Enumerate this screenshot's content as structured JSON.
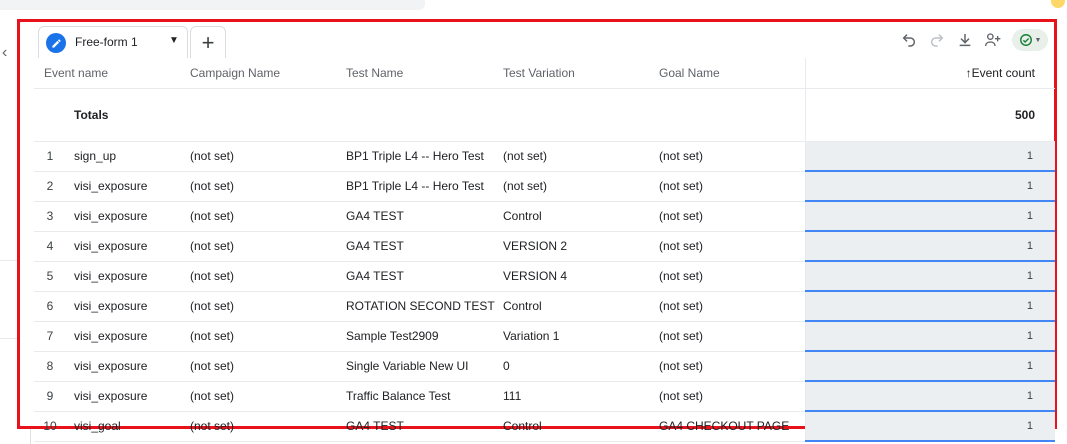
{
  "tab": {
    "label": "Free-form 1"
  },
  "columns": {
    "event_name": "Event name",
    "campaign_name": "Campaign Name",
    "test_name": "Test Name",
    "test_variation": "Test Variation",
    "goal_name": "Goal Name",
    "event_count": "↑Event count"
  },
  "totals": {
    "label": "Totals",
    "event_count": "500"
  },
  "rows": [
    {
      "index": "1",
      "event_name": "sign_up",
      "campaign": "(not set)",
      "test_name": "BP1 Triple L4 -- Hero Test",
      "variation": "(not set)",
      "goal": "(not set)",
      "count": "1"
    },
    {
      "index": "2",
      "event_name": "visi_exposure",
      "campaign": "(not set)",
      "test_name": "BP1 Triple L4 -- Hero Test",
      "variation": "(not set)",
      "goal": "(not set)",
      "count": "1"
    },
    {
      "index": "3",
      "event_name": "visi_exposure",
      "campaign": "(not set)",
      "test_name": "GA4 TEST",
      "variation": "Control",
      "goal": "(not set)",
      "count": "1"
    },
    {
      "index": "4",
      "event_name": "visi_exposure",
      "campaign": "(not set)",
      "test_name": "GA4 TEST",
      "variation": "VERSION 2",
      "goal": "(not set)",
      "count": "1"
    },
    {
      "index": "5",
      "event_name": "visi_exposure",
      "campaign": "(not set)",
      "test_name": "GA4 TEST",
      "variation": "VERSION 4",
      "goal": "(not set)",
      "count": "1"
    },
    {
      "index": "6",
      "event_name": "visi_exposure",
      "campaign": "(not set)",
      "test_name": "ROTATION SECOND TEST",
      "variation": "Control",
      "goal": "(not set)",
      "count": "1"
    },
    {
      "index": "7",
      "event_name": "visi_exposure",
      "campaign": "(not set)",
      "test_name": "Sample Test2909",
      "variation": "Variation 1",
      "goal": "(not set)",
      "count": "1"
    },
    {
      "index": "8",
      "event_name": "visi_exposure",
      "campaign": "(not set)",
      "test_name": "Single Variable New UI",
      "variation": "0",
      "goal": "(not set)",
      "count": "1"
    },
    {
      "index": "9",
      "event_name": "visi_exposure",
      "campaign": "(not set)",
      "test_name": "Traffic Balance Test",
      "variation": "111",
      "goal": "(not set)",
      "count": "1"
    },
    {
      "index": "10",
      "event_name": "visi_goal",
      "campaign": "(not set)",
      "test_name": "GA4 TEST",
      "variation": "Control",
      "goal": "GA4 CHECKOUT PAGE",
      "count": "1"
    }
  ],
  "icons": {
    "undo": "undo-icon",
    "redo": "redo-icon",
    "download": "download-icon",
    "share": "share-user-icon",
    "status": "check-circle-icon"
  },
  "colors": {
    "accent": "#1a73e8",
    "highlight_border": "#e8121b",
    "metric_bg": "#eceff1",
    "metric_underline": "#4285f4",
    "status_green": "#188038"
  }
}
